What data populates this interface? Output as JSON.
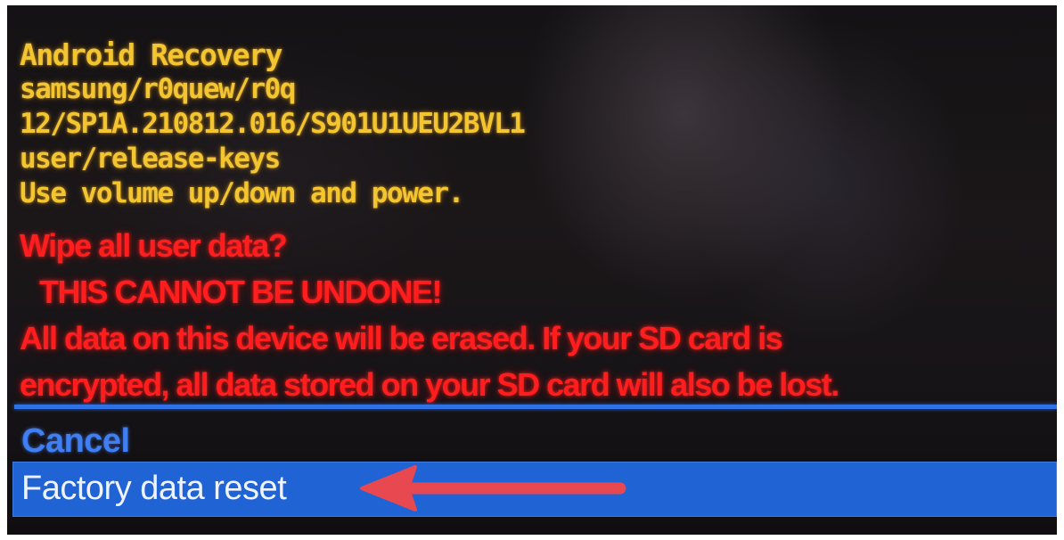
{
  "recovery": {
    "header_lines": [
      "Android Recovery",
      "samsung/r0quew/r0q",
      "12/SP1A.210812.016/S901U1UEU2BVL1",
      "user/release-keys",
      "Use volume up/down and power."
    ],
    "warning_lines": [
      "Wipe all user data?",
      "THIS CANNOT BE UNDONE!",
      "All data on this device will be erased. If your SD card is",
      "encrypted, all data stored on your SD card will also be lost."
    ],
    "menu": {
      "cancel_label": "Cancel",
      "factory_reset_label": "Factory data reset",
      "selected_item": "Factory data reset"
    }
  },
  "colors": {
    "header_text": "#f2c531",
    "warning_text": "#ff1d1d",
    "menu_accent": "#2f71e6",
    "selected_bg": "#1f63d4",
    "annotation_arrow": "#e8484f"
  },
  "icons": {
    "annotation": "arrow-left-icon"
  }
}
